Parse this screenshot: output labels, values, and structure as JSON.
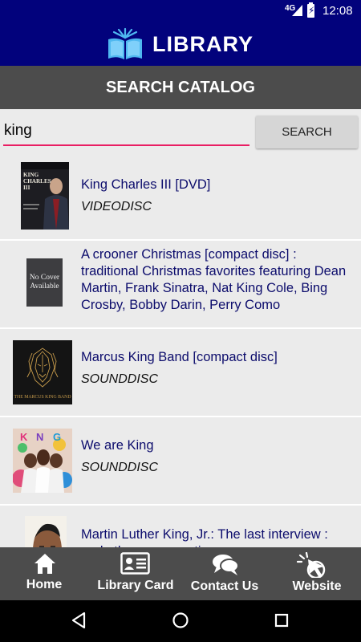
{
  "status_bar": {
    "network": "4G",
    "time": "12:08"
  },
  "header": {
    "app_title": "LIBRARY",
    "logo_icon": "open-book-icon"
  },
  "page": {
    "title": "SEARCH CATALOG"
  },
  "search": {
    "query": "king",
    "button_label": "SEARCH"
  },
  "results": [
    {
      "title": "King Charles III [DVD]",
      "format": "VIDEODISC",
      "cover": {
        "icon": "dvd-cover-king-charles",
        "text": "KING CHARLES III"
      }
    },
    {
      "title": "A crooner Christmas [compact disc] : traditional Christmas favorites featuring Dean Martin, Frank Sinatra, Nat King Cole, Bing Crosby, Bobby Darin, Perry Como",
      "format": "",
      "cover": {
        "icon": "no-cover-placeholder",
        "text": "No Cover Available"
      }
    },
    {
      "title": "Marcus King Band [compact disc]",
      "format": "SOUNDDISC",
      "cover": {
        "icon": "lion-album-cover",
        "text": "THE MARCUS KING BAND"
      }
    },
    {
      "title": "We are King",
      "format": "SOUNDDISC",
      "cover": {
        "icon": "king-album-cover",
        "text": "KING"
      }
    },
    {
      "title": "Martin Luther King, Jr.: The last interview : and other conversations",
      "format": "",
      "cover": {
        "icon": "mlk-portrait-cover",
        "text": ""
      }
    }
  ],
  "bottom_nav": [
    {
      "label": "Home",
      "icon": "home-icon"
    },
    {
      "label": "Library Card",
      "icon": "id-card-icon"
    },
    {
      "label": "Contact Us",
      "icon": "chat-bubbles-icon"
    },
    {
      "label": "Website",
      "icon": "cursor-click-icon"
    }
  ],
  "colors": {
    "header": "#02027c",
    "title_bar": "#4c4c4c",
    "accent_underline": "#e91e63",
    "result_title": "#0c0c6c",
    "background": "#ebebeb"
  }
}
